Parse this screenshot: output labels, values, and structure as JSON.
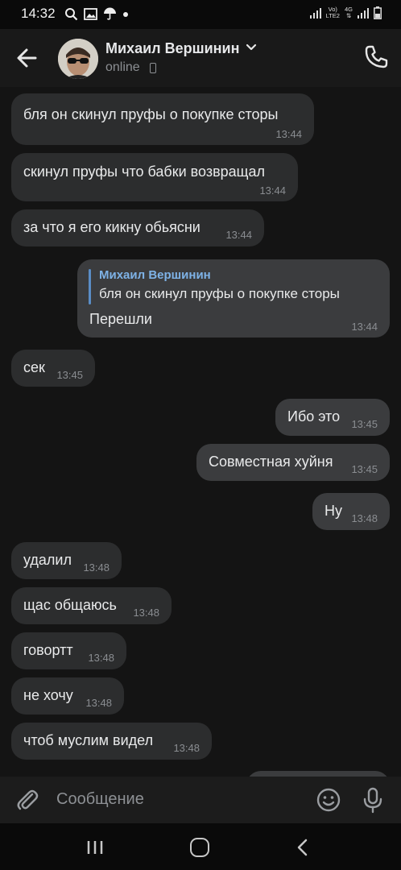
{
  "status_bar": {
    "time": "14:32",
    "net_label_top": "Vo)",
    "net_label_bottom": "LTE2",
    "net_4g_top": "4G",
    "net_4g_bottom": "⇅"
  },
  "header": {
    "contact_name": "Михаил Вершинин",
    "status": "online"
  },
  "messages": [
    {
      "direction": "in",
      "text": "бля он скинул пруфы о покупке сторы",
      "time": "13:44"
    },
    {
      "direction": "in",
      "text": "скинул пруфы что бабки возвращал",
      "time": "13:44"
    },
    {
      "direction": "in",
      "text": "за что я его кикну обьясни",
      "time": "13:44"
    },
    {
      "direction": "out",
      "reply_author": "Михаил Вершинин",
      "reply_text": "бля он скинул пруфы о покупке сторы",
      "text": "Перешли",
      "time": "13:44"
    },
    {
      "direction": "in",
      "text": "сек",
      "time": "13:45"
    },
    {
      "direction": "out",
      "text": "Ибо это",
      "time": "13:45"
    },
    {
      "direction": "out",
      "text": "Совместная хуйня",
      "time": "13:45"
    },
    {
      "direction": "out",
      "text": "Ну",
      "time": "13:48"
    },
    {
      "direction": "in",
      "text": "удалил",
      "time": "13:48"
    },
    {
      "direction": "in",
      "text": "щас общаюсь",
      "time": "13:48"
    },
    {
      "direction": "in",
      "text": "говортт",
      "time": "13:48"
    },
    {
      "direction": "in",
      "text": "не хочу",
      "time": "13:48"
    },
    {
      "direction": "in",
      "text": "чтоб муслим видел",
      "time": "13:48"
    }
  ],
  "composer": {
    "placeholder": "Сообщение"
  },
  "icons": {
    "back": "arrow-left-icon",
    "call": "phone-icon",
    "attach": "paperclip-icon",
    "emoji": "smiley-icon",
    "mic": "microphone-icon"
  },
  "colors": {
    "accent": "#7eb2e6",
    "incoming_bubble": "#2c2d2e",
    "outgoing_bubble": "#3b3c3e"
  }
}
